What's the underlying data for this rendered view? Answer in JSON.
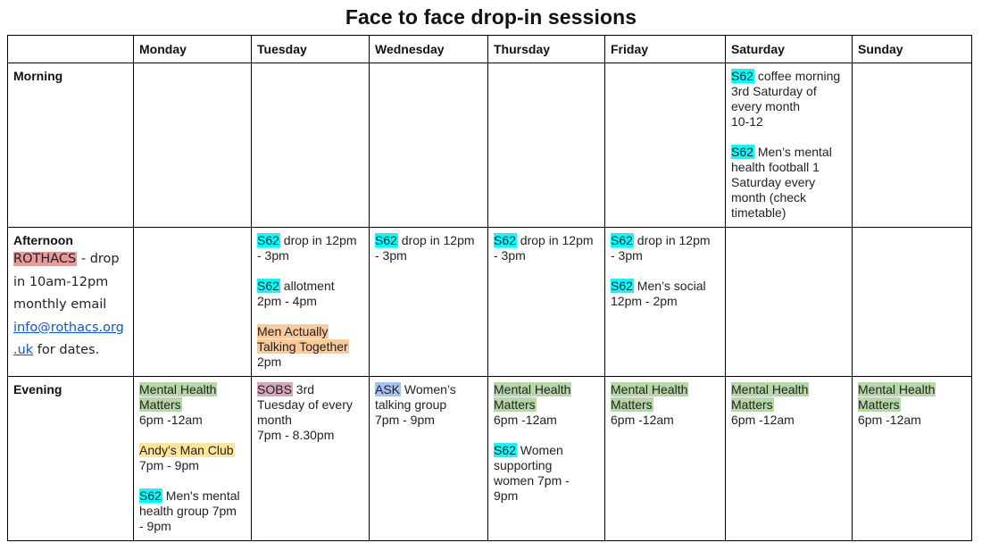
{
  "title": "Face to face drop-in sessions",
  "colors": {
    "s62": "#00ffff",
    "mental_health_matters": "#b6d7a8",
    "andys_man_club": "#ffe599",
    "matt": "#f9cb9c",
    "sobs": "#d5a6bd",
    "ask": "#a4c2f4",
    "rothacs": "#ea9999",
    "link": "#1155cc"
  },
  "header": {
    "corner": "",
    "days": [
      "Monday",
      "Tuesday",
      "Wednesday",
      "Thursday",
      "Friday",
      "Saturday",
      "Sunday"
    ]
  },
  "rows": {
    "morning": {
      "label": "Morning",
      "saturday": [
        {
          "tag": "S62",
          "lines": [
            "coffee morning",
            "3rd Saturday of",
            "every month",
            "10-12"
          ]
        },
        {
          "tag": "S62",
          "lines": [
            "Men’s mental",
            "health football 1",
            "Saturday every",
            "month (check",
            "timetable)"
          ]
        }
      ]
    },
    "afternoon": {
      "label": "Afternoon",
      "rothacs": {
        "tag": "ROTHACS",
        "text1": " - drop",
        "line2": "in 10am-12pm",
        "line3": "monthly email",
        "email_part1": "info@rothacs.org",
        "email_part2": ".uk",
        "line5_suffix": " for dates."
      },
      "tuesday": [
        {
          "tag": "S62",
          "text": " drop in 12pm",
          "line2": "- 3pm"
        },
        {
          "tag": "S62",
          "text": " allotment",
          "line2": "2pm - 4pm"
        },
        {
          "tag_line1": "Men Actually",
          "tag_line2": "Talking Together",
          "line3": "2pm"
        }
      ],
      "wednesday": [
        {
          "tag": "S62",
          "text": " drop in 12pm",
          "line2": "- 3pm"
        }
      ],
      "thursday": [
        {
          "tag": "S62",
          "text": " drop in 12pm",
          "line2": "- 3pm"
        }
      ],
      "friday": [
        {
          "tag": "S62",
          "text": " drop in 12pm",
          "line2": "- 3pm"
        },
        {
          "tag": "S62",
          "text": " Men’s social",
          "line2": "12pm - 2pm"
        }
      ]
    },
    "evening": {
      "label": "Evening",
      "monday": [
        {
          "tag_line1": "Mental Health",
          "tag_line2": "Matters",
          "line3": "6pm -12am"
        },
        {
          "tag": "Andy’s Man Club",
          "line2": "7pm - 9pm"
        },
        {
          "tag": "S62",
          "text": " Men's mental",
          "line2": "health group 7pm",
          "line3": "- 9pm"
        }
      ],
      "tuesday": [
        {
          "tag": "SOBS",
          "text": " 3rd",
          "line2": "Tuesday of every",
          "line3": "month",
          "line4": "7pm - 8.30pm"
        }
      ],
      "wednesday": [
        {
          "tag": "ASK",
          "text": " Women’s",
          "line2": "talking group",
          "line3": "7pm - 9pm"
        }
      ],
      "thursday": [
        {
          "tag_line1": "Mental Health",
          "tag_line2": "Matters",
          "line3": "6pm -12am"
        },
        {
          "tag": "S62",
          "text": " Women",
          "line2": "supporting",
          "line3": "women 7pm -",
          "line4": "9pm"
        }
      ],
      "friday": [
        {
          "tag_line1": "Mental Health",
          "tag_line2": "Matters",
          "line3": "6pm -12am"
        }
      ],
      "saturday": [
        {
          "tag_line1": "Mental Health",
          "tag_line2": "Matters",
          "line3": "6pm -12am"
        }
      ],
      "sunday": [
        {
          "tag_line1": "Mental Health",
          "tag_line2": "Matters",
          "line3": "6pm -12am"
        }
      ]
    }
  }
}
